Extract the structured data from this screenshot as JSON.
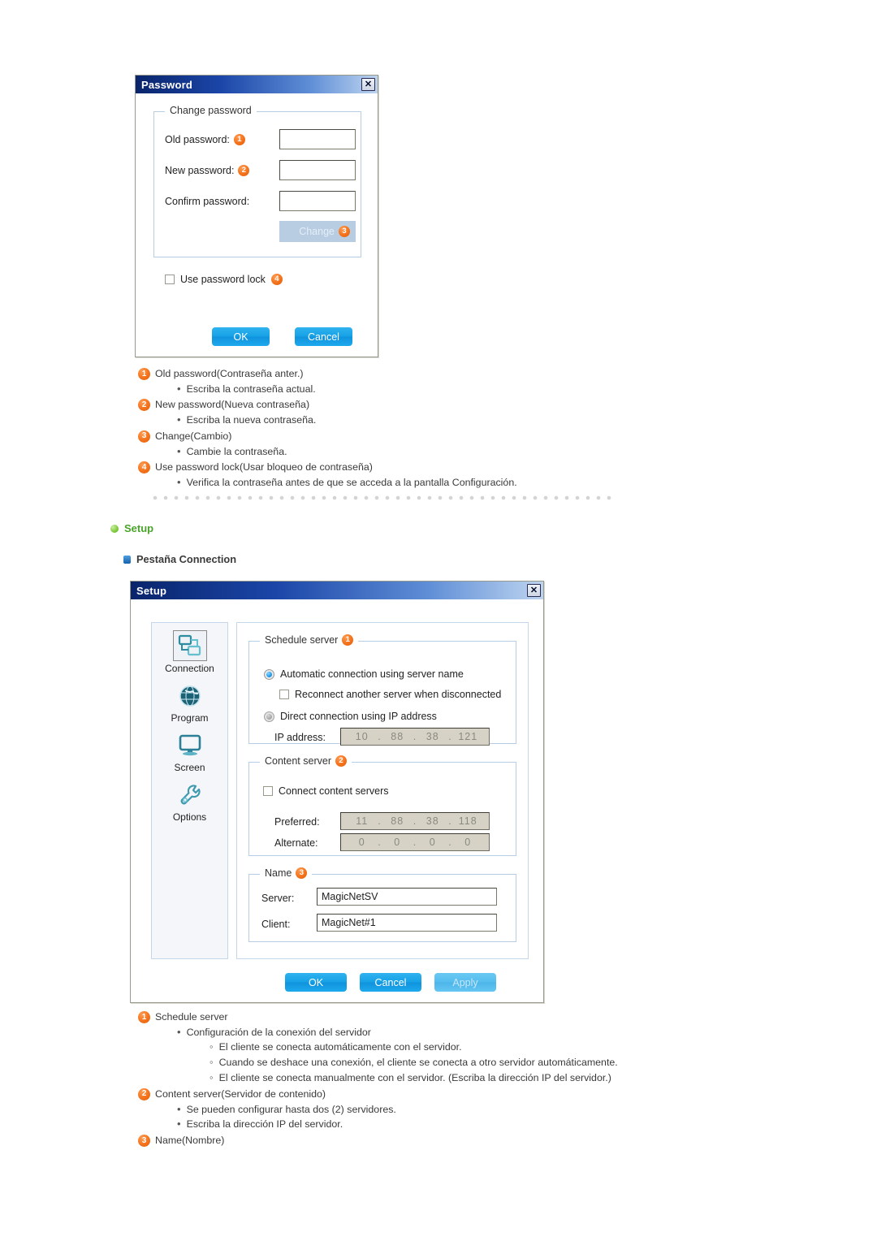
{
  "password_dialog": {
    "title": "Password",
    "close_icon": "close-icon",
    "group_legend": "Change password",
    "fields": [
      {
        "label": "Old password:",
        "badge": "1",
        "value": ""
      },
      {
        "label": "New password:",
        "badge": "2",
        "value": ""
      },
      {
        "label": "Confirm password:",
        "badge": "",
        "value": ""
      }
    ],
    "change_button": {
      "label": "Change",
      "badge": "3"
    },
    "password_lock": {
      "label": "Use password lock",
      "badge": "4",
      "checked": false
    },
    "ok_label": "OK",
    "cancel_label": "Cancel"
  },
  "password_notes": [
    {
      "badge": "1",
      "text": "Old password(Contraseña anter.)"
    },
    {
      "level": 2,
      "text": "Escriba la contraseña actual."
    },
    {
      "badge": "2",
      "text": "New password(Nueva contraseña)"
    },
    {
      "level": 2,
      "text": "Escriba la nueva contraseña."
    },
    {
      "badge": "3",
      "text": "Change(Cambio)"
    },
    {
      "level": 2,
      "text": "Cambie la contraseña."
    },
    {
      "badge": "4",
      "text": "Use password lock(Usar bloqueo de contraseña)"
    },
    {
      "level": 2,
      "text": "Verifica la contraseña antes de que se acceda a la pantalla Configuración."
    }
  ],
  "headings": {
    "setup": "Setup",
    "tab": "Pestaña Connection"
  },
  "setup_dialog": {
    "title": "Setup",
    "close_icon": "close-icon",
    "nav": [
      {
        "label": "Connection",
        "icon": "connection-icon",
        "selected": true
      },
      {
        "label": "Program",
        "icon": "globe-icon",
        "selected": false
      },
      {
        "label": "Screen",
        "icon": "monitor-icon",
        "selected": false
      },
      {
        "label": "Options",
        "icon": "wrench-icon",
        "selected": false
      }
    ],
    "schedule_server": {
      "legend": "Schedule server",
      "badge": "1",
      "radio_auto": {
        "label": "Automatic connection using server name",
        "selected": true
      },
      "reconnect_checkbox": {
        "label": "Reconnect another server when disconnected",
        "checked": false
      },
      "radio_direct": {
        "label": "Direct connection using IP address",
        "selected": false
      },
      "ip_label": "IP address:",
      "ip_value": [
        "10",
        "88",
        "38",
        "121"
      ]
    },
    "content_server": {
      "legend": "Content server",
      "badge": "2",
      "connect_checkbox": {
        "label": "Connect content servers",
        "checked": false
      },
      "preferred_label": "Preferred:",
      "preferred_value": [
        "11",
        "88",
        "38",
        "118"
      ],
      "alternate_label": "Alternate:",
      "alternate_value": [
        "0",
        "0",
        "0",
        "0"
      ]
    },
    "name": {
      "legend": "Name",
      "badge": "3",
      "server_label": "Server:",
      "server_value": "MagicNetSV",
      "client_label": "Client:",
      "client_value": "MagicNet#1"
    },
    "ok_label": "OK",
    "cancel_label": "Cancel",
    "apply_label": "Apply"
  },
  "setup_notes": [
    {
      "badge": "1",
      "text": "Schedule server"
    },
    {
      "level": 2,
      "text": "Configuración de la conexión del servidor"
    },
    {
      "level": 3,
      "text": "El cliente se conecta automáticamente con el servidor."
    },
    {
      "level": 3,
      "text": "Cuando se deshace una conexión, el cliente se conecta a otro servidor automáticamente."
    },
    {
      "level": 3,
      "text": "El cliente se conecta manualmente con el servidor. (Escriba la dirección IP del servidor.)"
    },
    {
      "badge": "2",
      "text": "Content server(Servidor de contenido)"
    },
    {
      "level": 2,
      "text": "Se pueden configurar hasta dos (2) servidores."
    },
    {
      "level": 2,
      "text": "Escriba la dirección IP del servidor."
    },
    {
      "badge": "3",
      "text": "Name(Nombre)"
    }
  ],
  "colors": {
    "badge_orange": "#f4721b",
    "button_blue": "#17a2e6",
    "title_blue": "#09246b",
    "heading_green": "#4aa32a",
    "group_border": "#b7cde3"
  }
}
